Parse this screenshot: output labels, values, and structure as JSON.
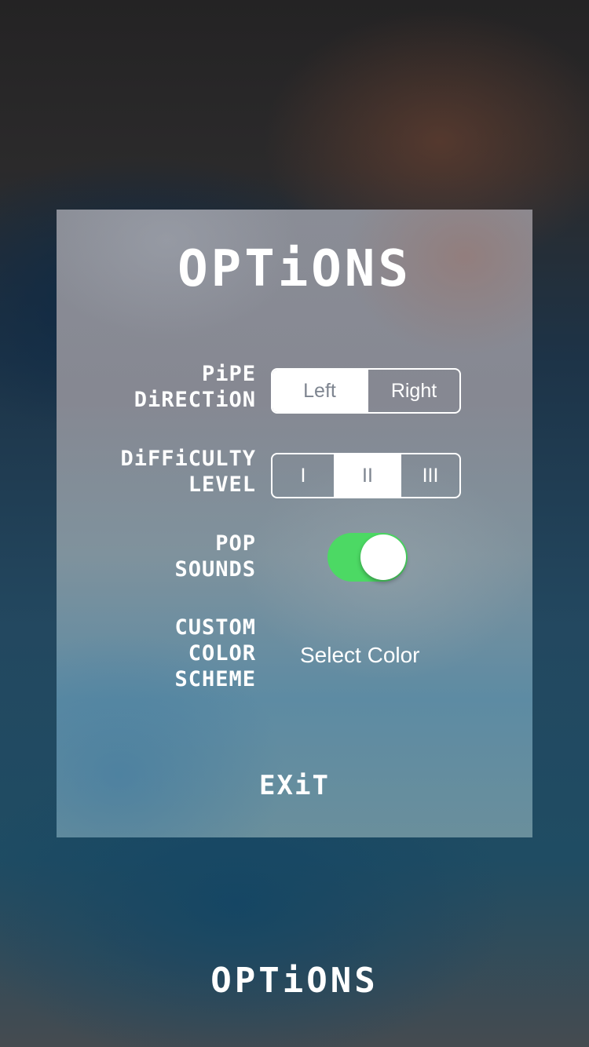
{
  "panel": {
    "title": "OPTiONS"
  },
  "pipe_direction": {
    "label_line1": "PiPE",
    "label_line2": "DiRECTiON",
    "options": [
      "Left",
      "Right"
    ],
    "selected": "Left"
  },
  "difficulty": {
    "label_line1": "DiFFiCULTY",
    "label_line2": "LEVEL",
    "options": [
      "I",
      "II",
      "III"
    ],
    "selected": "II"
  },
  "pop_sounds": {
    "label_line1": "POP",
    "label_line2": "SOUNDS",
    "enabled": true,
    "on_color": "#4cd964"
  },
  "color_scheme": {
    "label_line1": "CUSTOM",
    "label_line2": "COLOR",
    "label_line3": "SCHEME",
    "button_label": "Select Color"
  },
  "exit_label": "EXiT",
  "background_title": "OPTiONS"
}
